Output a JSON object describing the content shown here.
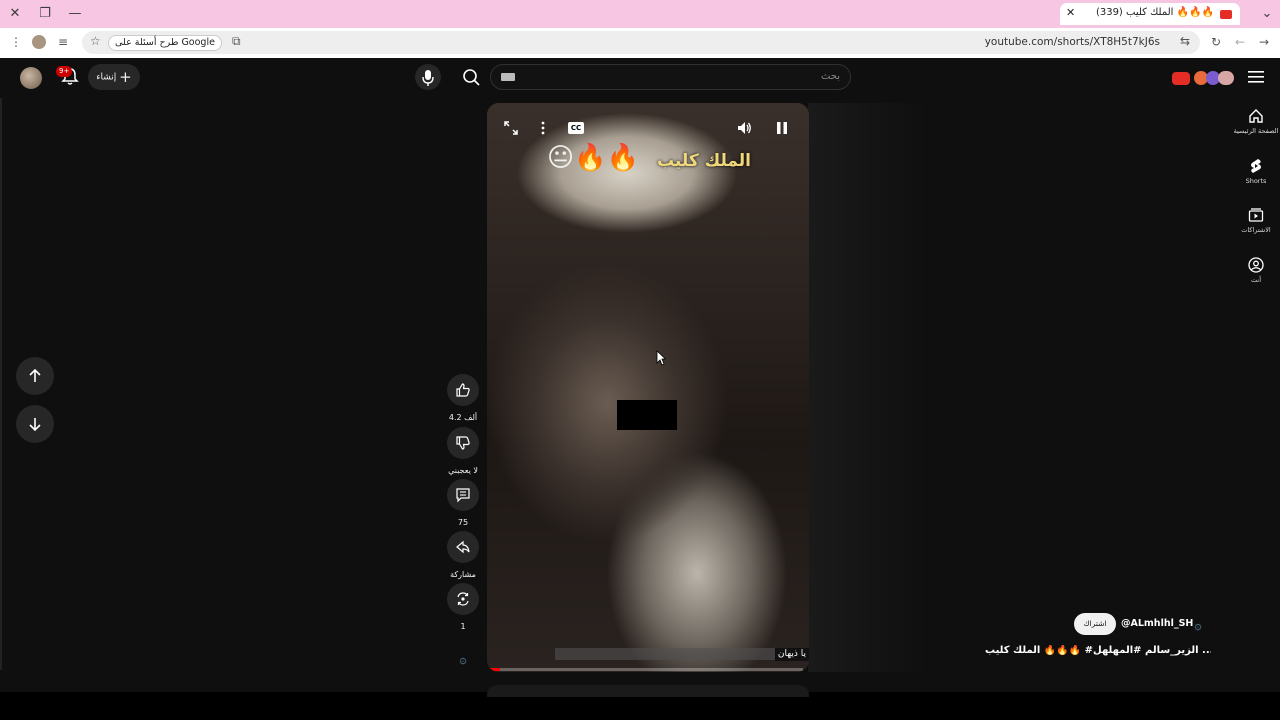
{
  "browser": {
    "tab_title": "(339) الملك كليب 🔥🔥🔥‎",
    "url": "youtube.com/shorts/XT8H5t7kJ6s",
    "google_chip": "طرح أسئلة على Google"
  },
  "header": {
    "search_placeholder": "بحث",
    "create_label": "إنشاء",
    "notifications_badge": "9+"
  },
  "side_nav": [
    {
      "label": "الصفحة الرئيسية",
      "icon": "home-icon"
    },
    {
      "label": "Shorts",
      "icon": "shorts-icon"
    },
    {
      "label": "الاشتراكات",
      "icon": "subscriptions-icon"
    },
    {
      "label": "أنت",
      "icon": "you-icon"
    }
  ],
  "video": {
    "overlay_title": "الملك كليب",
    "overlay_emoji": "😐🔥🔥",
    "caption": "يا ذيهان",
    "cc_label": "CC",
    "progress": 0.04
  },
  "actions": {
    "likes": "4.2 ألف",
    "dislike_label": "لا يعجبني",
    "comments": "75",
    "share_label": "مشاركة",
    "remix_count": "1"
  },
  "channel": {
    "handle": "@ALmhlhl_SH",
    "subscribe_label": "اشتراك",
    "avatar_glyph": "۞",
    "description": "الملك كليب 🔥🔥🔥‎ #الزير_سالم #المهلهل ..."
  }
}
